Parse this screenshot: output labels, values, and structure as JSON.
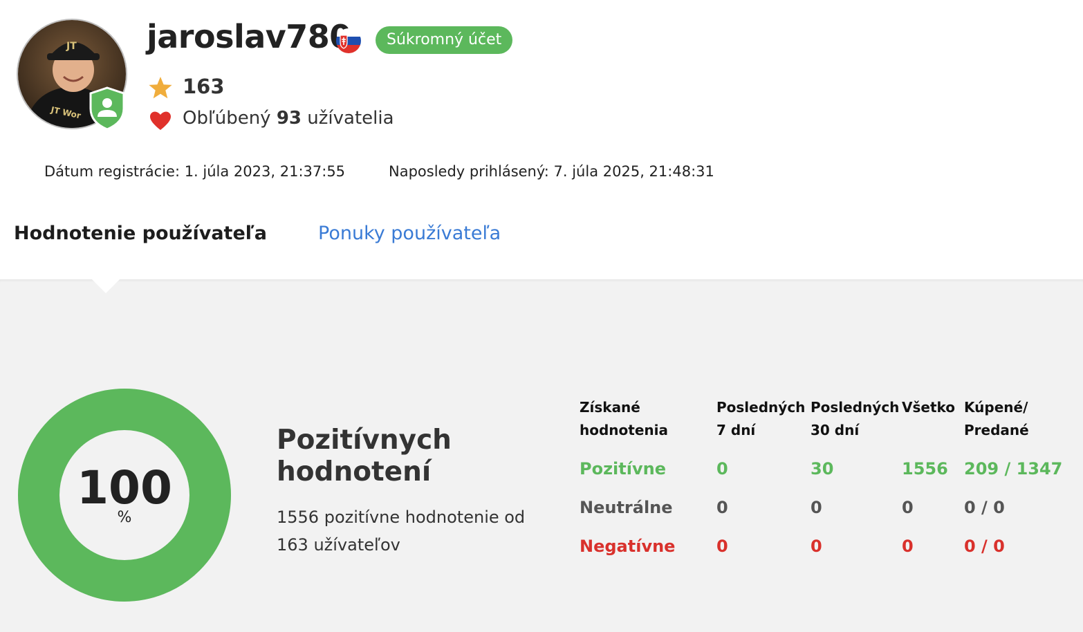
{
  "profile": {
    "username": "jaroslav780",
    "account_type_badge": "Súkromný účet",
    "country_flag_icon": "slovakia-flag-icon",
    "rating_score": "163",
    "favorite_prefix": "Obľúbený",
    "favorite_count": "93",
    "favorite_suffix": "užívatelia",
    "registration_label": "Dátum registrácie: 1. júla 2023, 21:37:55",
    "last_login_label": "Naposledy prihlásený: 7. júla 2025, 21:48:31"
  },
  "tabs": [
    {
      "label": "Hodnotenie používateľa",
      "active": true
    },
    {
      "label": "Ponuky používateľa",
      "active": false
    }
  ],
  "summary": {
    "percent_value": "100",
    "percent_unit": "%",
    "percent_positive": 100,
    "title": "Pozitívnych hodnotení",
    "description": "1556 pozitívne hodnotenie od 163 užívateľov"
  },
  "ratings_table": {
    "headers": [
      "Získané hodnotenia",
      "Posledných 7 dní",
      "Posledných 30 dní",
      "Všetko",
      "Kúpené/ Predané"
    ],
    "rows": [
      {
        "label": "Pozitívne",
        "values": [
          "0",
          "30",
          "1556",
          "209 / 1347"
        ]
      },
      {
        "label": "Neutrálne",
        "values": [
          "0",
          "0",
          "0",
          "0 / 0"
        ]
      },
      {
        "label": "Negatívne",
        "values": [
          "0",
          "0",
          "0",
          "0 / 0"
        ]
      }
    ]
  },
  "colors": {
    "positive": "#5cb85c",
    "neutral": "#555555",
    "negative": "#d9312c",
    "link": "#3a7bd5",
    "panel_bg": "#f2f2f2"
  }
}
